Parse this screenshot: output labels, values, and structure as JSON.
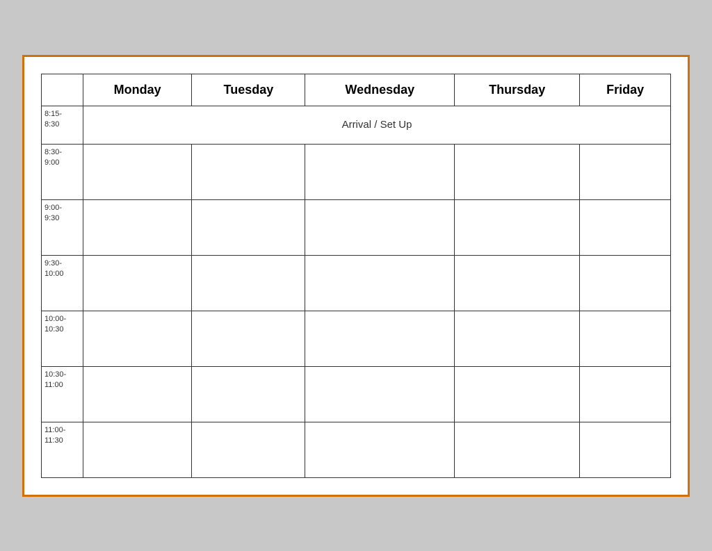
{
  "table": {
    "columns": [
      {
        "id": "time",
        "label": ""
      },
      {
        "id": "monday",
        "label": "Monday"
      },
      {
        "id": "tuesday",
        "label": "Tuesday"
      },
      {
        "id": "wednesday",
        "label": "Wednesday"
      },
      {
        "id": "thursday",
        "label": "Thursday"
      },
      {
        "id": "friday",
        "label": "Friday"
      }
    ],
    "arrival_row": {
      "time": "8:15-\n8:30",
      "content": "Arrival / Set Up"
    },
    "time_slots": [
      "8:30-\n9:00",
      "9:00-\n9:30",
      "9:30-\n10:00",
      "10:00-\n10:30",
      "10:30-\n11:00",
      "11:00-\n11:30"
    ]
  }
}
